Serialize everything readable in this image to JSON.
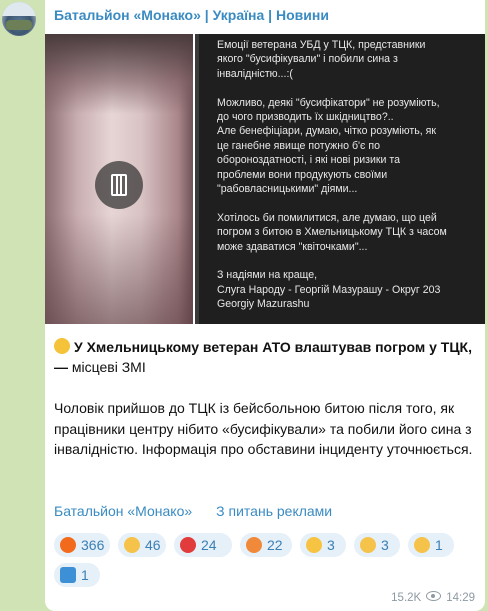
{
  "channel": {
    "name": "Батальйон «Монако» | Україна | Новини"
  },
  "media": {
    "screenshot_paragraphs": [
      "Емоції ветерана УБД у ТЦК, представники\nякого \"бусифікували\" і побили сина з\nінвалідністю...:(",
      "Можливо, деякі \"бусифікатори\" не розуміють,\nдо чого призводить їх шкідництво?..\nАле бенефіціари, думаю, чітко розуміють, як\nце ганебне явище потужно б'є по\nобороноздатності, і які нові ризики та\nпроблеми вони продукують своїми\n\"рабовласницькими\" діями...",
      "Хотілось би помилитися, але думаю, що цей\nпогром з битою в Хмельницькому ТЦК з часом\nможе здаватися \"квіточками\"...",
      "З надіями на краще,\nСлуга Народу - Георгій Мазурашу - Округ 203\nGeorgiy Mazurashu"
    ]
  },
  "post": {
    "headline_bold": "У Хмельницькому ветеран АТО влаштував погром у ТЦК, —",
    "headline_rest": " місцеві ЗМІ",
    "body": "Чоловік прийшов до ТЦК із бейсбольною битою після того, як працівники центру нібито «бусифікували» та побили його сина з інвалідністю. Інформація про обставини інциденту уточнюється."
  },
  "links": {
    "channel_link": "Батальйон «Монако»",
    "ads_link": "З питань реклами"
  },
  "reactions": [
    {
      "icon": "fire-icon",
      "count": "366",
      "color": "#f26b1d"
    },
    {
      "icon": "thumbs-up-icon",
      "count": "46",
      "color": "#f5c24a"
    },
    {
      "icon": "heart-on-fire-icon",
      "count": "24",
      "color": "#e23b3b"
    },
    {
      "icon": "exploding-head-icon",
      "count": "22",
      "color": "#f08a3a"
    },
    {
      "icon": "smiling-with-hearts-icon",
      "count": "3",
      "color": "#f6c343"
    },
    {
      "icon": "thinking-face-icon",
      "count": "3",
      "color": "#f5c24a"
    },
    {
      "icon": "woozy-face-icon",
      "count": "1",
      "color": "#f5c24a"
    },
    {
      "icon": "cool-button-icon",
      "count": "1",
      "color": "#3d8fd6"
    }
  ],
  "footer": {
    "views": "15.2K",
    "time": "14:29"
  }
}
